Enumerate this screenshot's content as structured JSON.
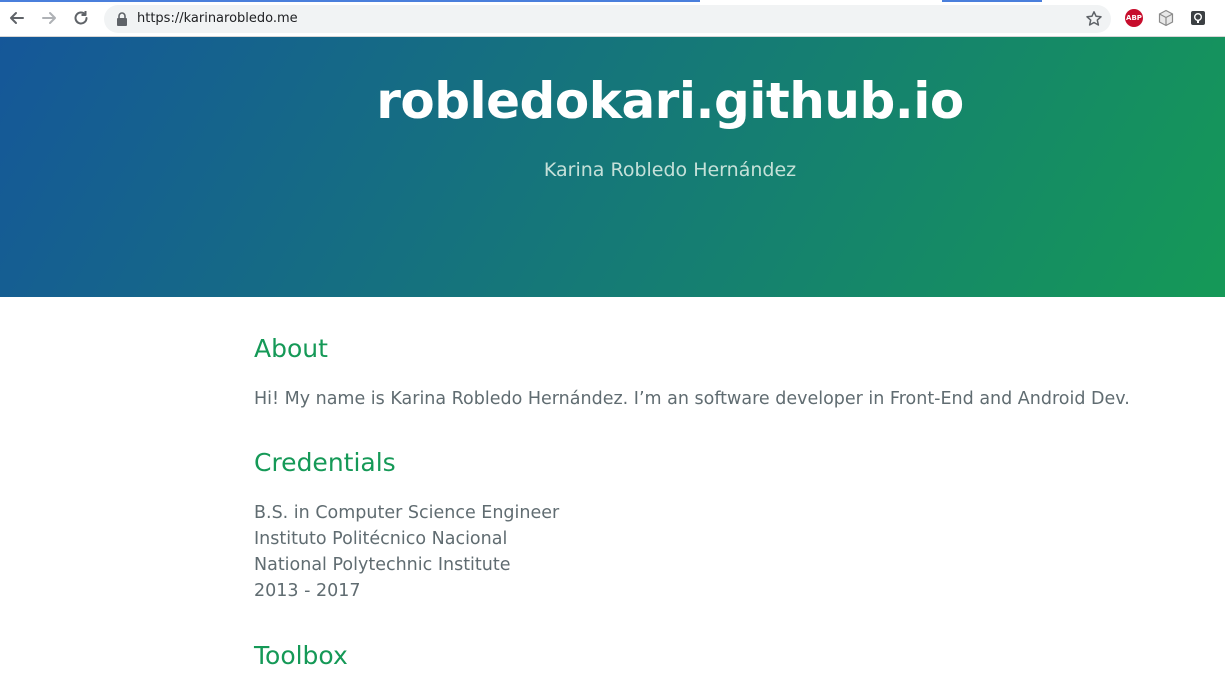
{
  "browser": {
    "url": "https://karinarobledo.me",
    "extensions": [
      "ABP",
      "cube-extension",
      "lightbulb-extension"
    ]
  },
  "hero": {
    "title": "robledokari.github.io",
    "tagline": "Karina Robledo Hernández"
  },
  "about": {
    "heading": "About",
    "text": "Hi! My name is Karina Robledo Hernández. I’m an software developer in Front-End and Android Dev."
  },
  "credentials": {
    "heading": "Credentials",
    "lines": [
      "B.S. in Computer Science Engineer",
      "Instituto Politécnico Nacional",
      "National Polytechnic Institute",
      "2013 - 2017"
    ]
  },
  "toolbox": {
    "heading": "Toolbox"
  },
  "colors": {
    "gradient_start": "#155799",
    "gradient_end": "#159957",
    "heading_green": "#159957",
    "body_text": "#606c71"
  }
}
